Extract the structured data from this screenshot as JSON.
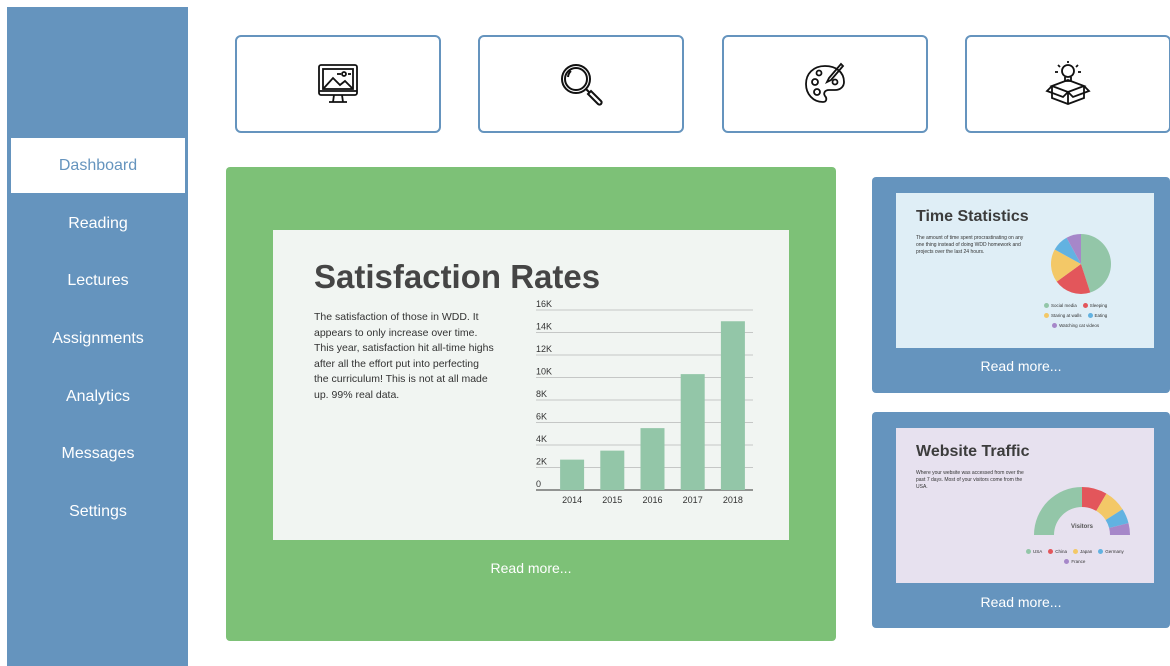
{
  "colors": {
    "sidebar": "#6594be",
    "main_card": "#7dc177",
    "bar": "#93c6a8",
    "social": "#93c6a8",
    "sleeping": "#e3565b",
    "walls": "#f3c867",
    "eating": "#62b2e1",
    "cats": "#a687c9"
  },
  "sidebar": {
    "items": [
      {
        "label": "Dashboard"
      },
      {
        "label": "Reading"
      },
      {
        "label": "Lectures"
      },
      {
        "label": "Assignments"
      },
      {
        "label": "Analytics"
      },
      {
        "label": "Messages"
      },
      {
        "label": "Settings"
      }
    ]
  },
  "tiles": [
    {
      "icon": "monitor-image-icon"
    },
    {
      "icon": "magnifier-icon"
    },
    {
      "icon": "paint-palette-icon"
    },
    {
      "icon": "idea-box-icon"
    }
  ],
  "main_card": {
    "title": "Satisfaction Rates",
    "description": "The satisfaction of those in WDD. It appears to only increase over time. This year, satisfaction hit all-time highs after all the effort put into perfecting the curriculum! This is not at all made up. 99% real data.",
    "read_more": "Read more..."
  },
  "time_card": {
    "title": "Time Statistics",
    "description": "The amount of time spent procrastinating on any one thing instead of doing WDD homework and projects over the last 24 hours.",
    "legend": [
      "Social media",
      "Sleeping",
      "Staring at walls",
      "Eating",
      "Watching cat videos"
    ],
    "read_more": "Read more..."
  },
  "traffic_card": {
    "title": "Website Traffic",
    "description": "Where your website was accessed from over the past 7 days. Most of your visitors come from the USA.",
    "center_label": "Visitors",
    "legend": [
      "USA",
      "China",
      "Japan",
      "Germany",
      "France"
    ],
    "read_more": "Read more..."
  },
  "chart_data": [
    {
      "type": "bar",
      "categories": [
        "2014",
        "2015",
        "2016",
        "2017",
        "2018"
      ],
      "values": [
        2700,
        3500,
        5500,
        10300,
        15000
      ],
      "ylim": [
        0,
        16000
      ],
      "yticks": [
        "0",
        "2K",
        "4K",
        "6K",
        "8K",
        "10K",
        "12K",
        "14K",
        "16K"
      ],
      "grid": true
    },
    {
      "type": "pie",
      "categories": [
        "Social media",
        "Sleeping",
        "Staring at walls",
        "Eating",
        "Watching cat videos"
      ],
      "values": [
        45,
        20,
        18,
        9,
        8
      ],
      "legend": "bottom"
    },
    {
      "type": "pie",
      "categories": [
        "USA",
        "China",
        "Japan",
        "Germany",
        "France"
      ],
      "values": [
        50,
        17,
        15,
        10,
        8
      ],
      "legend": "bottom"
    }
  ]
}
